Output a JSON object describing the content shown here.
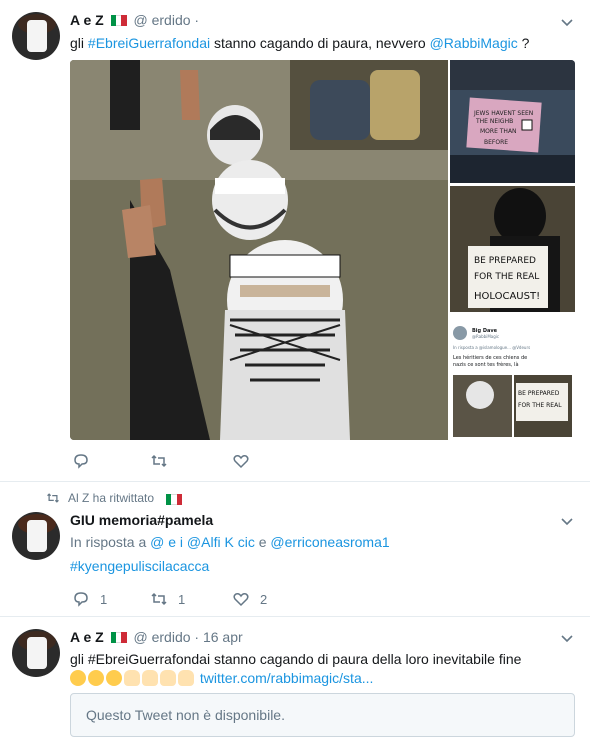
{
  "tweet1": {
    "name": "A        e Z    ",
    "handle": "@        erdido ·",
    "text_prefix": "gli ",
    "hashtag": "#EbreiGuerrafondai",
    "text_middle": " stanno cagando di paura, nevvero ",
    "mention": "@RabbiMagic",
    "text_suffix": " ?",
    "media_side": {
      "sign1": "JEWS HAVENT SEEN\nTHE NEIGHBOURS\nMORE THAN\nBEFORE",
      "sign2": "BE PREPARED\nFOR THE REAL\nHOLOCAUST!",
      "embedded_name": "Big Dave",
      "embedded_handle": "@RabbiMagic",
      "embedded_reply": "In risposta a @islamologue...ENI & @Vdeurs",
      "embedded_text": "Les héritiers de ces chiens de nazis ce sont tes frères, là 👇",
      "sign3": "BE PREPARED\nFOR THE REAL"
    },
    "actions": {
      "reply": "",
      "retweet": "",
      "like": ""
    }
  },
  "tweet2": {
    "retweet_note": "Al          Z           ha ritwittato",
    "name": "GIU memoria#pamela",
    "reply_prefix": "In risposta a ",
    "reply_mentions": "@  e        i        @Alfi   K     cic",
    "reply_and": " e ",
    "reply_last": "@erriconeasroma1",
    "hashtag": "#kyengepuliscilacacca",
    "actions": {
      "reply": "1",
      "retweet": "1",
      "like": "2"
    }
  },
  "tweet3": {
    "name": "A        e Z    ",
    "handle": "@    erdido · 16 apr",
    "hashtag": "gli #EbreiGuerrafondai stanno cagando di paura della loro inevitabile fine",
    "link": "twitter.com/rabbimagic/sta...",
    "unavailable": "Questo Tweet non è disponibile."
  },
  "colors": {
    "accent": "#1b95e0",
    "muted": "#657786",
    "border": "#e6ecf0",
    "flag_green": "#009246",
    "flag_white": "#ffffff",
    "flag_red": "#ce2b37"
  }
}
